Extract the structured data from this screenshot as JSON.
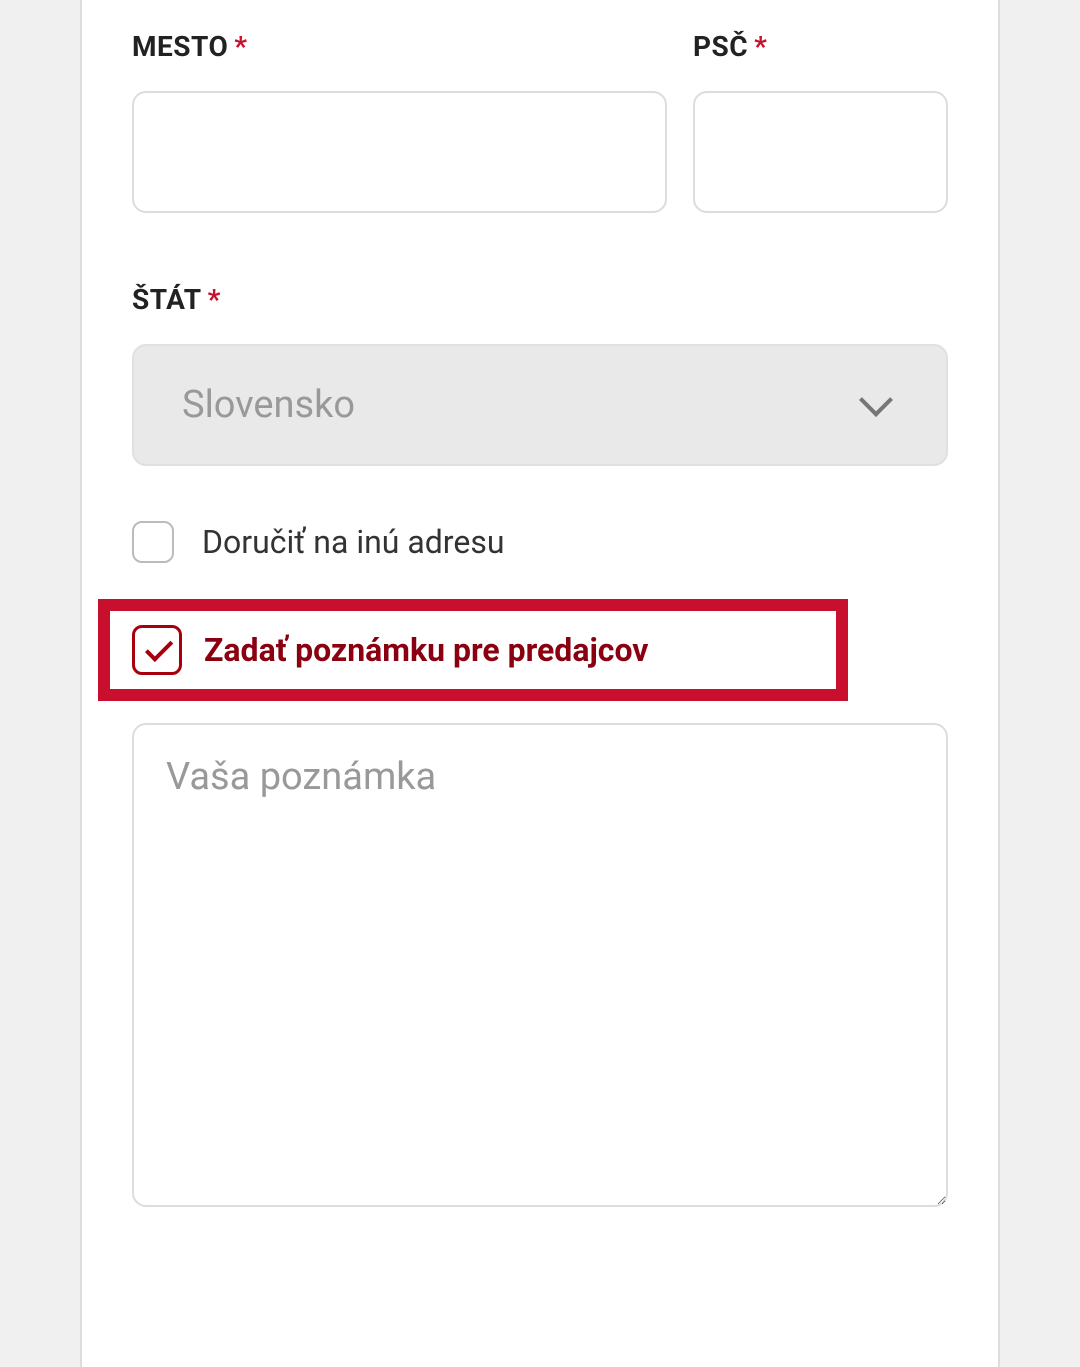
{
  "fields": {
    "city": {
      "label": "MESTO",
      "value": ""
    },
    "zip": {
      "label": "PSČ",
      "value": ""
    },
    "state": {
      "label": "ŠTÁT",
      "selected": "Slovensko"
    }
  },
  "required_marker": "*",
  "options": {
    "different_address": {
      "label": "Doručiť na inú adresu",
      "checked": false
    },
    "seller_note": {
      "label": "Zadať poznámku pre predajcov",
      "checked": true
    }
  },
  "note": {
    "placeholder": "Vaša poznámka",
    "value": ""
  }
}
